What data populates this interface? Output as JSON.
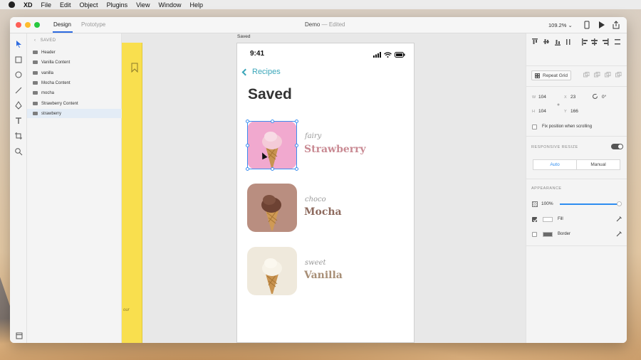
{
  "menubar": {
    "app": "XD",
    "items": [
      "File",
      "Edit",
      "Object",
      "Plugins",
      "View",
      "Window",
      "Help"
    ]
  },
  "titlebar": {
    "tabs": [
      "Design",
      "Prototype"
    ],
    "document": "Demo",
    "separator": "—",
    "status": "Edited",
    "zoom": "109.2%"
  },
  "layers": {
    "header": "SAVED",
    "items": [
      "Header",
      "Vanilla Content",
      "vanilla",
      "Mocha Content",
      "mocha",
      "Strawberry Content",
      "strawberry"
    ]
  },
  "canvas": {
    "artboard_label": "Saved",
    "status_time": "9:41",
    "back_label": "Recipes",
    "page_title": "Saved",
    "yellow_text": "our",
    "recipes": [
      {
        "adjective": "fairy",
        "name": "Strawberry",
        "name_color": "#c98a93"
      },
      {
        "adjective": "choco",
        "name": "Mocha",
        "name_color": "#8d6a5e"
      },
      {
        "adjective": "sweet",
        "name": "Vanilla",
        "name_color": "#a88f77"
      }
    ]
  },
  "inspector": {
    "repeat_grid": "Repeat Grid",
    "w_label": "W",
    "w_value": "104",
    "h_label": "H",
    "h_value": "104",
    "x_label": "X",
    "x_value": "23",
    "y_label": "Y",
    "y_value": "166",
    "rotation": "0°",
    "fix_position": "Fix position when scrolling",
    "responsive_resize": "RESPONSIVE RESIZE",
    "auto": "Auto",
    "manual": "Manual",
    "appearance": "APPEARANCE",
    "opacity": "100%",
    "opacity_level": 1.0,
    "fill": "Fill",
    "border": "Border"
  },
  "colors": {
    "accent": "#2d8cf0",
    "back_link": "#3aa6b9",
    "yellow_board": "#f9df4e"
  }
}
